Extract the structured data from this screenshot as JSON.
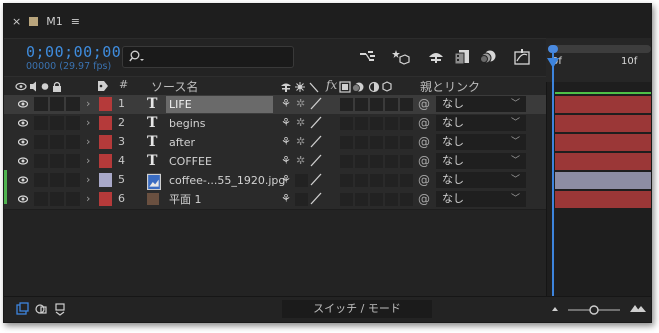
{
  "tab": {
    "close": "×",
    "title": "M1",
    "menu": "≡",
    "swatch_color": "#b9a57d"
  },
  "timecode": "0;00;00;00",
  "fps_text": "00000 (29.97 fps)",
  "search": {
    "placeholder": ""
  },
  "toolbar_icons": [
    "comp-flowchart-icon",
    "draft-3d-icon",
    "shy-layers-icon",
    "frame-blending-icon",
    "motion-blur-icon",
    "graph-editor-icon"
  ],
  "ruler": {
    "labels": [
      "0f",
      "10f"
    ]
  },
  "columns": {
    "name": "ソース名",
    "fx": "fx",
    "parent": "親とリンク",
    "number": "#"
  },
  "layers": [
    {
      "num": "1",
      "type": "text",
      "type_glyph": "T",
      "name": "LIFE",
      "label_color": "#b53a3a",
      "parent": "なし",
      "selected": true,
      "bar_color": "#9b3737"
    },
    {
      "num": "2",
      "type": "text",
      "type_glyph": "T",
      "name": "begins",
      "label_color": "#b53a3a",
      "parent": "なし",
      "selected": false,
      "bar_color": "#9b3737"
    },
    {
      "num": "3",
      "type": "text",
      "type_glyph": "T",
      "name": "after",
      "label_color": "#b53a3a",
      "parent": "なし",
      "selected": false,
      "bar_color": "#9b3737"
    },
    {
      "num": "4",
      "type": "text",
      "type_glyph": "T",
      "name": "COFFEE",
      "label_color": "#b53a3a",
      "parent": "なし",
      "selected": false,
      "bar_color": "#9b3737"
    },
    {
      "num": "5",
      "type": "image",
      "type_glyph": "",
      "name": "coffee-...55_1920.jpg",
      "label_color": "#a9a9c9",
      "parent": "なし",
      "selected": false,
      "bar_color": "#8d8da3"
    },
    {
      "num": "6",
      "type": "solid",
      "type_glyph": "",
      "name": "平面 1",
      "label_color": "#b53a3a",
      "parent": "なし",
      "selected": false,
      "bar_color": "#9b3737"
    }
  ],
  "bottom": {
    "switch_mode": "スイッチ / モード"
  },
  "colors": {
    "accent": "#3f8cdd",
    "timeline_green": "#4ec147"
  }
}
